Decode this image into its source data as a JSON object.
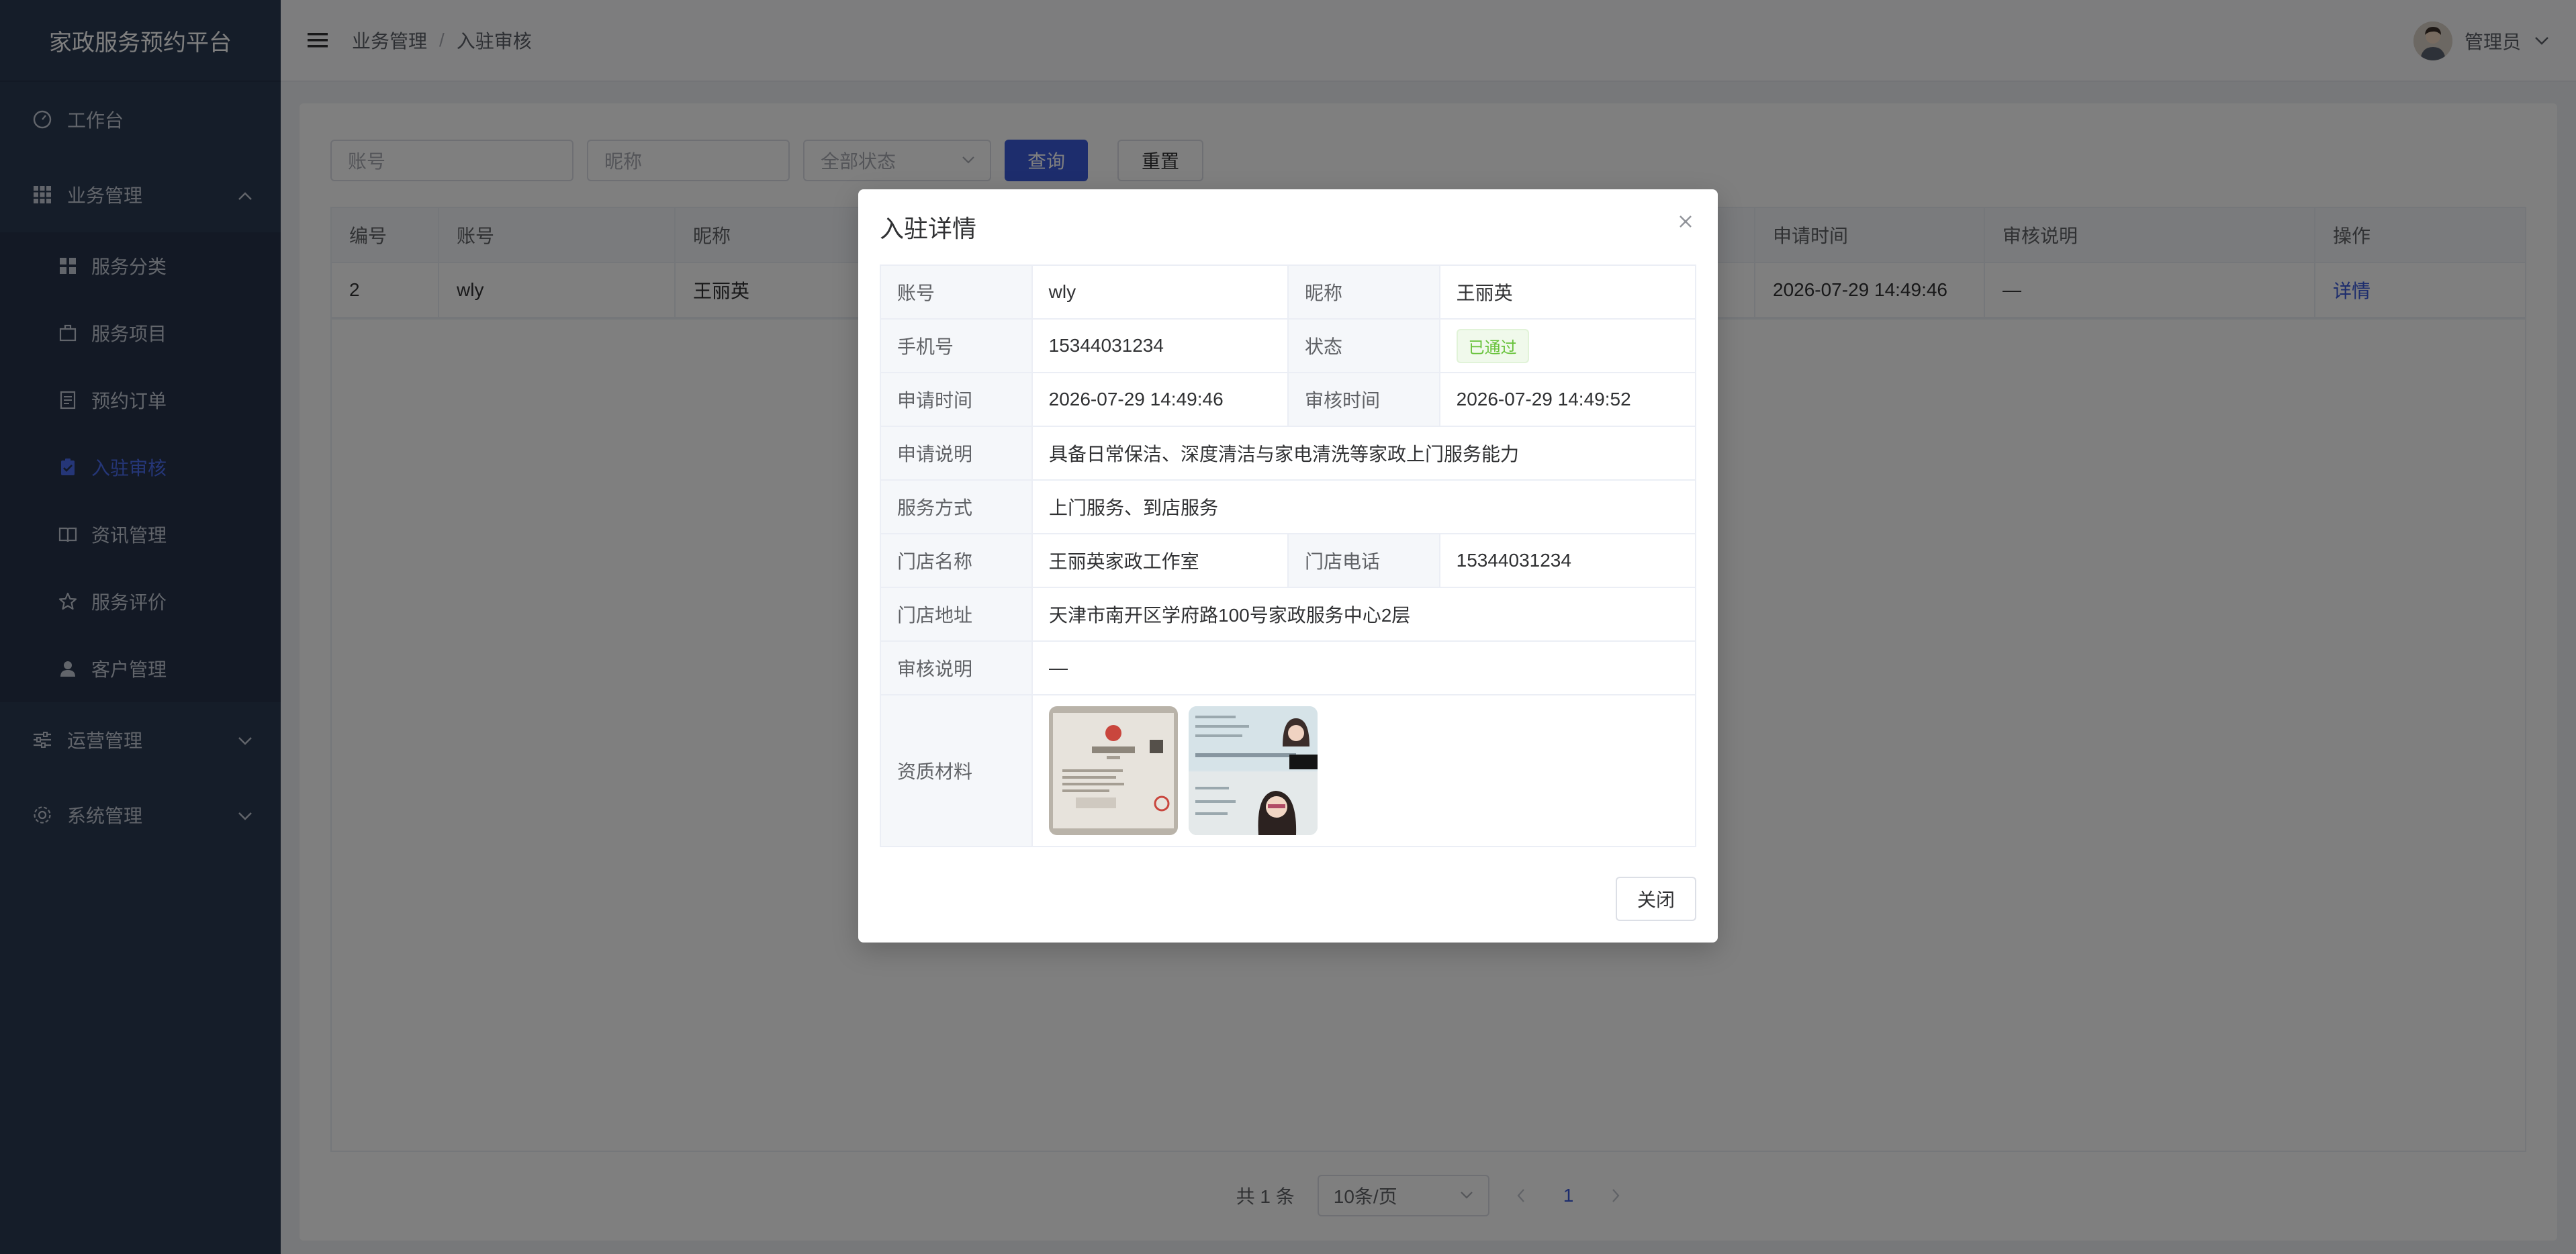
{
  "app": {
    "title": "家政服务预约平台"
  },
  "sidebar": {
    "items": [
      {
        "label": "工作台",
        "icon": "dashboard-icon"
      },
      {
        "label": "业务管理",
        "icon": "grid-icon",
        "expanded": true,
        "children": [
          {
            "label": "服务分类",
            "icon": "category-icon"
          },
          {
            "label": "服务项目",
            "icon": "briefcase-icon"
          },
          {
            "label": "预约订单",
            "icon": "document-icon"
          },
          {
            "label": "入驻审核",
            "icon": "clipboard-check-icon",
            "active": true
          },
          {
            "label": "资讯管理",
            "icon": "book-icon"
          },
          {
            "label": "服务评价",
            "icon": "star-icon"
          },
          {
            "label": "客户管理",
            "icon": "user-icon"
          }
        ]
      },
      {
        "label": "运营管理",
        "icon": "sliders-icon"
      },
      {
        "label": "系统管理",
        "icon": "gear-icon"
      }
    ]
  },
  "header": {
    "breadcrumb": [
      "业务管理",
      "入驻审核"
    ],
    "user": "管理员"
  },
  "filters": {
    "account_placeholder": "账号",
    "nickname_placeholder": "昵称",
    "status_value": "全部状态",
    "search_label": "查询",
    "reset_label": "重置"
  },
  "table": {
    "columns": [
      "编号",
      "账号",
      "昵称",
      "申请时间",
      "审核说明",
      "操作"
    ],
    "rows": [
      {
        "id": "2",
        "account": "wly",
        "nickname": "王丽英",
        "apply_time": "2026-07-29 14:49:46",
        "remark": "—",
        "action": "详情"
      }
    ]
  },
  "pagination": {
    "total": "共 1 条",
    "page_size": "10条/页",
    "current": "1"
  },
  "dialog": {
    "title": "入驻详情",
    "labels": {
      "account": "账号",
      "nickname": "昵称",
      "phone": "手机号",
      "status": "状态",
      "apply_time": "申请时间",
      "review_time": "审核时间",
      "apply_note": "申请说明",
      "service_mode": "服务方式",
      "store_name": "门店名称",
      "store_phone": "门店电话",
      "store_address": "门店地址",
      "review_note": "审核说明",
      "materials": "资质材料"
    },
    "values": {
      "account": "wly",
      "nickname": "王丽英",
      "phone": "15344031234",
      "status": "已通过",
      "apply_time": "2026-07-29 14:49:46",
      "review_time": "2026-07-29 14:49:52",
      "apply_note": "具备日常保洁、深度清洁与家电清洗等家政上门服务能力",
      "service_mode": "上门服务、到店服务",
      "store_name": "王丽英家政工作室",
      "store_phone": "15344031234",
      "store_address": "天津市南开区学府路100号家政服务中心2层",
      "review_note": "—"
    },
    "close_label": "关闭",
    "colors": {
      "accent": "#3b5bdb",
      "success": "#67c23a",
      "sidebar": "#2b3a52"
    }
  }
}
